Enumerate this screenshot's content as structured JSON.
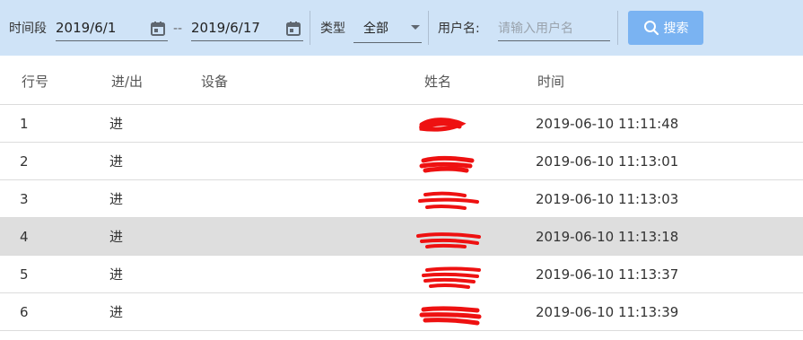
{
  "filters": {
    "period_label": "时间段",
    "start_date": "2019/6/1",
    "range_sep": "--",
    "end_date": "2019/6/17",
    "type_label": "类型",
    "type_value": "全部",
    "username_label": "用户名:",
    "username_placeholder": "请输入用户名",
    "search_label": "搜索"
  },
  "table": {
    "headers": [
      "行号",
      "进/出",
      "设备",
      "姓名",
      "时间"
    ],
    "rows": [
      {
        "no": "1",
        "direction": "进",
        "device": "",
        "name": "",
        "time": "2019-06-10 11:11:48"
      },
      {
        "no": "2",
        "direction": "进",
        "device": "",
        "name": "",
        "time": "2019-06-10 11:13:01"
      },
      {
        "no": "3",
        "direction": "进",
        "device": "",
        "name": "",
        "time": "2019-06-10 11:13:03"
      },
      {
        "no": "4",
        "direction": "进",
        "device": "",
        "name": "",
        "time": "2019-06-10 11:13:18"
      },
      {
        "no": "5",
        "direction": "进",
        "device": "",
        "name": "",
        "time": "2019-06-10 11:13:37"
      },
      {
        "no": "6",
        "direction": "进",
        "device": "",
        "name": "",
        "time": "2019-06-10 11:13:39"
      }
    ],
    "selected_row": 4
  },
  "colors": {
    "toolbar_bg": "#cfe3f7",
    "search_button": "#7ab3f2",
    "selected_row": "#dedede",
    "redaction": "#ee1111"
  },
  "icons": [
    "calendar-icon",
    "chevron-down-icon",
    "search-icon"
  ]
}
